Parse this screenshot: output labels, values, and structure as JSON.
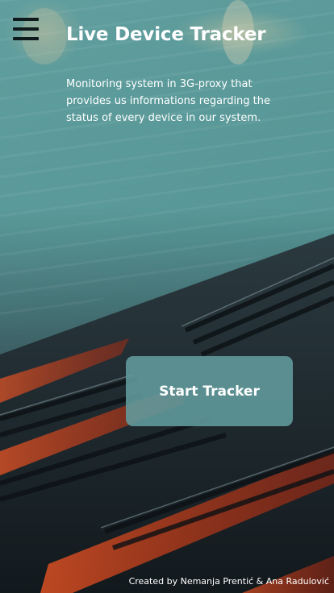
{
  "header": {
    "menu_icon": "hamburger-menu-icon",
    "title": "Live Device Tracker"
  },
  "main": {
    "description": "Monitoring system in 3G-proxy that provides us informations regarding the status of every device in our system.",
    "start_button_label": "Start Tracker"
  },
  "footer": {
    "credits": "Created by Nemanja Prentić & Ana Radulović"
  },
  "colors": {
    "text": "#ffffff",
    "button_background": "#629c9e",
    "teal_background": "#4f9291",
    "cable_highlight": "#ff4a1c"
  }
}
